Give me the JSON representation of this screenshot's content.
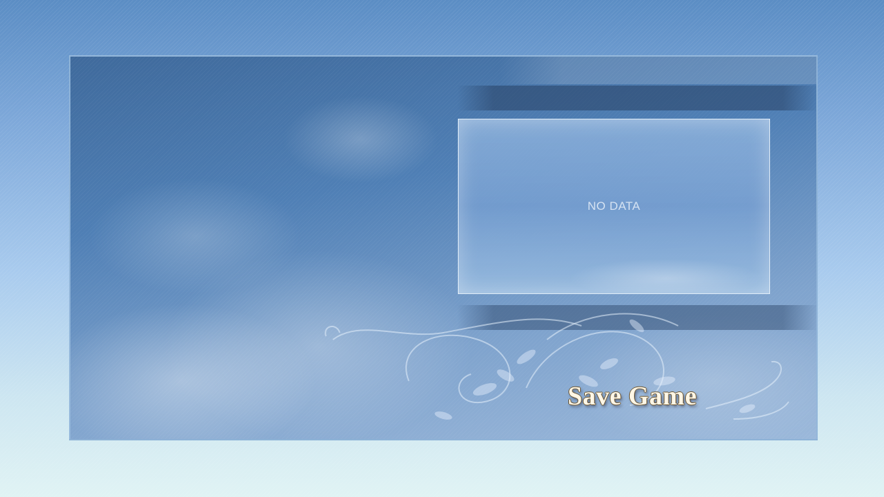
{
  "screen": {
    "title": "Save Game"
  },
  "save_slots": [
    {
      "label": "NO DATA"
    }
  ],
  "icons": {
    "ornament": "floral-swirl-icon"
  },
  "colors": {
    "sky_top": "#5b8dc4",
    "sky_bottom": "#e0f3f4",
    "title_fill": "#fdf6e6",
    "title_outline": "#6a5430"
  }
}
